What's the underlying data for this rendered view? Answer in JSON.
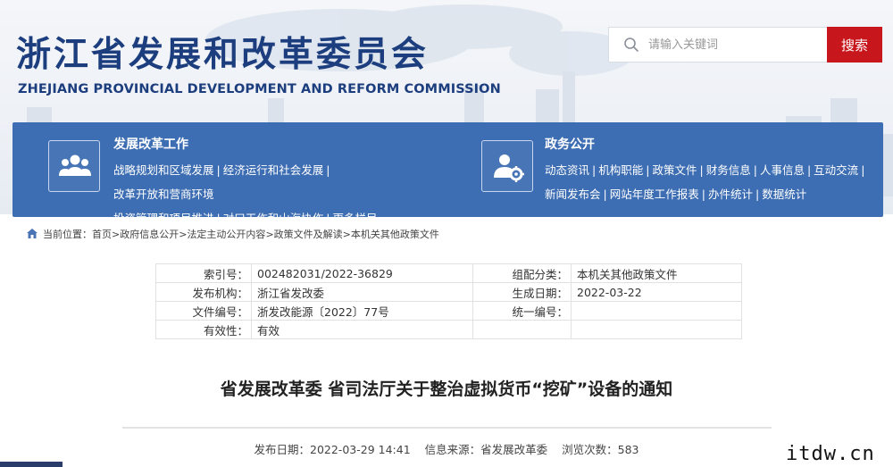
{
  "header": {
    "site_title": "浙江省发展和改革委员会",
    "site_subtitle": "ZHEJIANG PROVINCIAL DEVELOPMENT AND REFORM COMMISSION"
  },
  "search": {
    "placeholder": "请输入关键词",
    "button_label": "搜索"
  },
  "nav": {
    "left": {
      "title": "发展改革工作",
      "icon": "people-group-icon",
      "links": [
        "战略规划和区域发展",
        "经济运行和社会发展",
        "改革开放和营商环境",
        "投资管理和项目推进",
        "对口工作和山海协作",
        "更多栏目"
      ]
    },
    "right": {
      "title": "政务公开",
      "icon": "user-gear-icon",
      "links": [
        "动态资讯",
        "机构职能",
        "政策文件",
        "财务信息",
        "人事信息",
        "互动交流",
        "新闻发布会",
        "网站年度工作报表",
        "办件统计",
        "数据统计"
      ]
    }
  },
  "breadcrumb": {
    "prefix": "当前位置：",
    "items": [
      "首页",
      "政府信息公开",
      "法定主动公开内容",
      "政策文件及解读",
      "本机关其他政策文件"
    ]
  },
  "info": {
    "rows": [
      {
        "k1": "索引号：",
        "v1": "002482031/2022-36829",
        "k2": "组配分类：",
        "v2": "本机关其他政策文件"
      },
      {
        "k1": "发布机构：",
        "v1": "浙江省发改委",
        "k2": "生成日期：",
        "v2": "2022-03-22"
      },
      {
        "k1": "文件编号：",
        "v1": "浙发改能源〔2022〕77号",
        "k2": "统一编号：",
        "v2": ""
      },
      {
        "k1": "有效性：",
        "v1": "有效"
      }
    ]
  },
  "article": {
    "title": "省发展改革委 省司法厅关于整治虚拟货币“挖矿”设备的通知",
    "publish_date": "发布日期：2022-03-29 14:41",
    "source": "信息来源：省发展改革委",
    "views": "浏览次数：583"
  },
  "watermark": "itdw.cn",
  "colors": {
    "brand_blue": "#1d3e7e",
    "nav_blue": "#3d6db2",
    "search_red": "#c8161d"
  }
}
